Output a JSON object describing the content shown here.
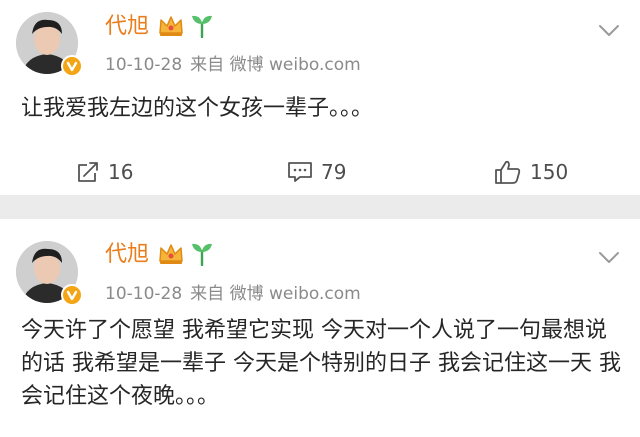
{
  "posts": [
    {
      "author": "代旭",
      "date": "10-10-28",
      "source": "来自 微博 weibo.com",
      "text": "让我爱我左边的这个女孩一辈子。。。",
      "repost_count": "16",
      "comment_count": "79",
      "like_count": "150"
    },
    {
      "author": "代旭",
      "date": "10-10-28",
      "source": "来自 微博 weibo.com",
      "text": "今天许了个愿望 我希望它实现 今天对一个人说了一句最想说的话 我希望是一辈子 今天是个特别的日子 我会记住这一天 我会记住这个夜晚。。。"
    }
  ],
  "icons": {
    "crown": "crown-badge-icon",
    "sprout": "sprout-icon",
    "menu": "chevron-down-icon",
    "repost": "repost-icon",
    "comment": "comment-icon",
    "like": "thumbs-up-icon",
    "verified": "verified-badge-icon"
  },
  "colors": {
    "author": "#ea7d1c",
    "meta": "#8a8a8a",
    "separator": "#ebebeb",
    "badge": "#f3a516"
  }
}
